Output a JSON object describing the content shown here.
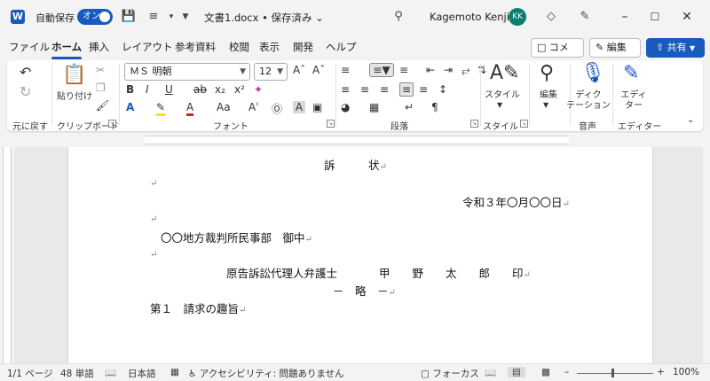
{
  "titlebar": {
    "autosave_label": "自動保存",
    "autosave_state": "オン",
    "doc_title": "文書1.docx • 保存済み ⌄",
    "user_name": "Kagemoto Kenji",
    "user_initials": "KK"
  },
  "tabs": [
    "ファイル",
    "ホーム",
    "挿入",
    "レイアウト",
    "参考資料",
    "校閲",
    "表示",
    "開発",
    "ヘルプ"
  ],
  "actions": {
    "comment": "コメント",
    "edit": "編集",
    "share": "共有"
  },
  "ribbon": {
    "groups": {
      "undo": "元に戻す",
      "clipboard": "クリップボード",
      "font": "フォント",
      "paragraph": "段落",
      "styles": "スタイル",
      "voice": "音声",
      "editor": "エディター"
    },
    "paste_label": "貼り付け",
    "font_name": "ＭＳ 明朝",
    "font_size": "12",
    "styles_label": "スタイル",
    "editing_label": "編集",
    "dictation_label_1": "ディク",
    "dictation_label_2": "テーション",
    "editor_label_1": "エディ",
    "editor_label_2": "ター"
  },
  "document": {
    "line1": "訴　　　状",
    "line2": "令和３年〇月〇〇日",
    "line3": "〇〇地方裁判所民事部　御中",
    "line4_label": "原告訴訟代理人弁護士",
    "line4_name": "甲　　野　　太　　郎　　印",
    "line5": "－　略　－",
    "line6": "第１　請求の趣旨"
  },
  "status": {
    "page": "1/1 ページ",
    "words": "48 単語",
    "language": "日本語",
    "accessibility": "アクセシビリティ: 問題ありません",
    "focus": "フォーカス",
    "zoom": "100%"
  }
}
